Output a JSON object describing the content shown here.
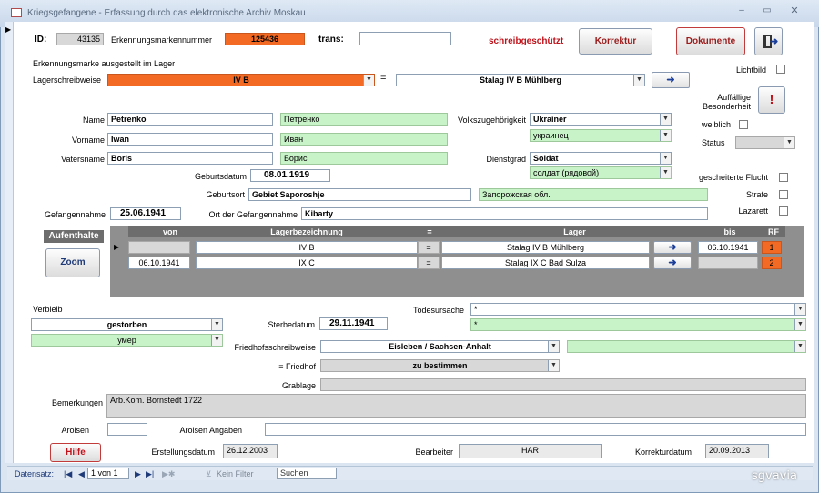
{
  "window": {
    "title": "Kriegsgefangene - Erfassung durch das elektronische Archiv Moskau"
  },
  "header": {
    "id_label": "ID:",
    "id_value": "43135",
    "erkennungsmarke_label": "Erkennungsmarkennummer",
    "erkennungsmarke_value": "125436",
    "trans_label": "trans:",
    "trans_value": "",
    "readonly_text": "schreibgeschützt",
    "korrektur_button": "Korrektur",
    "dokumente_button": "Dokumente"
  },
  "lager": {
    "ausgestellt_label": "Erkennungsmarke ausgestellt im Lager",
    "schreibweise_label": "Lagerschreibweise",
    "schreibweise_value": "IV B",
    "equals": "=",
    "lager_value": "Stalag IV B Mühlberg"
  },
  "right_panel": {
    "lichtbild_label": "Lichtbild",
    "auffaellige_label_1": "Auffällige",
    "auffaellige_label_2": "Besonderheit",
    "weiblich_label": "weiblich",
    "status_label": "Status",
    "status_value": "",
    "flucht_label": "gescheiterte Flucht",
    "strafe_label": "Strafe",
    "lazarett_label": "Lazarett"
  },
  "person": {
    "name_label": "Name",
    "name_value": "Petrenko",
    "name_cyr": "Петренко",
    "vorname_label": "Vorname",
    "vorname_value": "Iwan",
    "vorname_cyr": "Иван",
    "vatersname_label": "Vatersname",
    "vatersname_value": "Boris",
    "vatersname_cyr": "Борис",
    "volk_label": "Volkszugehörigkeit",
    "volk_value": "Ukrainer",
    "volk_cyr": "украинец",
    "dienstgrad_label": "Dienstgrad",
    "dienstgrad_value": "Soldat",
    "dienstgrad_cyr": "солдат (рядовой)",
    "geburtsdatum_label": "Geburtsdatum",
    "geburtsdatum_value": "08.01.1919",
    "geburtsort_label": "Geburtsort",
    "geburtsort_value": "Gebiet Saporoshje",
    "geburtsort_cyr": "Запорожская обл.",
    "gefangennahme_label": "Gefangennahme",
    "gefangennahme_value": "25.06.1941",
    "ort_label": "Ort der Gefangennahme",
    "ort_value": "Kibarty"
  },
  "aufenthalte": {
    "title": "Aufenthalte",
    "zoom_button": "Zoom",
    "columns": [
      "von",
      "Lagerbezeichnung",
      "=",
      "Lager",
      "bis",
      "RF"
    ],
    "rows": [
      {
        "von": "",
        "bezeichnung": "IV B",
        "eq": "=",
        "lager": "Stalag IV B Mühlberg",
        "bis": "06.10.1941",
        "rf": "1"
      },
      {
        "von": "06.10.1941",
        "bezeichnung": "IX C",
        "eq": "=",
        "lager": "Stalag IX C Bad Sulza",
        "bis": "",
        "rf": "2"
      }
    ]
  },
  "verbleib": {
    "label": "Verbleib",
    "value": "gestorben",
    "cyr": "умер",
    "todesursache_label": "Todesursache",
    "todesursache_value": "*",
    "todesursache_cyr": "*",
    "sterbedatum_label": "Sterbedatum",
    "sterbedatum_value": "29.11.1941",
    "friedhof_schreib_label": "Friedhofsschreibweise",
    "friedhof_schreib_value": "Eisleben / Sachsen-Anhalt",
    "friedhof_label": "= Friedhof",
    "friedhof_value": "zu bestimmen",
    "grablage_label": "Grablage",
    "grablage_value": ""
  },
  "footer": {
    "bemerkungen_label": "Bemerkungen",
    "bemerkungen_value": "Arb.Kom. Bornstedt 1722",
    "arolsen_label": "Arolsen",
    "arolsen_value": "",
    "arolsen_angaben_label": "Arolsen Angaben",
    "arolsen_angaben_value": "",
    "hilfe_button": "Hilfe",
    "erstellung_label": "Erstellungsdatum",
    "erstellung_value": "26.12.2003",
    "bearbeiter_label": "Bearbeiter",
    "bearbeiter_value": "HAR",
    "korrektur_label": "Korrekturdatum",
    "korrektur_value": "20.09.2013"
  },
  "statusbar": {
    "datensatz_label": "Datensatz:",
    "record_value": "1 von 1",
    "filter_label": "Kein Filter",
    "search_label": "Suchen"
  },
  "watermark": "sgvavia",
  "colors": {
    "orange": "#f26a24",
    "green": "#c8f2c8",
    "accent_red": "#c0121a"
  }
}
